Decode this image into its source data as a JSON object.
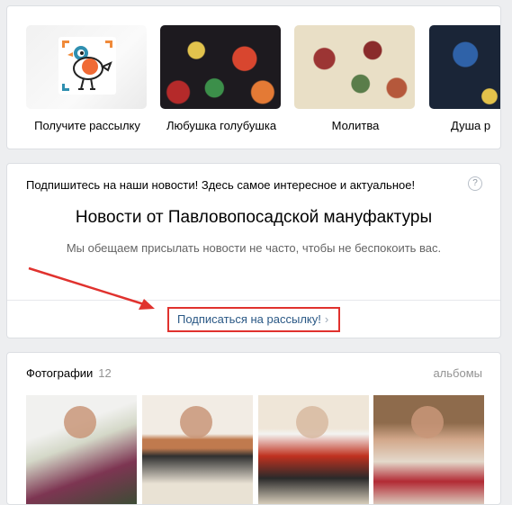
{
  "products": {
    "items": [
      {
        "label": "Получите рассылку",
        "kind": "logo"
      },
      {
        "label": "Любушка голубушка",
        "kind": "shawl"
      },
      {
        "label": "Молитва",
        "kind": "shawl"
      },
      {
        "label": "Душа р",
        "kind": "shawl"
      }
    ]
  },
  "subscribe": {
    "intro": "Подпишитесь на наши новости! Здесь самое интересное и актуальное!",
    "help_icon": "?",
    "title": "Новости от Павловопосадской мануфактуры",
    "description": "Мы обещаем присылать новости не часто, чтобы не беспокоить вас.",
    "link_label": "Подписаться на рассылку!",
    "link_chevron": "›",
    "highlight_color": "#e0322e"
  },
  "photos": {
    "heading": "Фотографии",
    "count": "12",
    "albums_link": "альбомы"
  },
  "colors": {
    "link": "#2a5885",
    "muted": "#939393",
    "page_bg": "#edeef0"
  }
}
